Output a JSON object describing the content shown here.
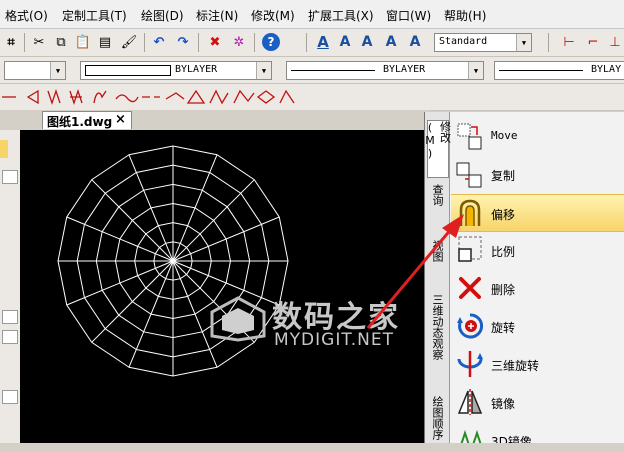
{
  "menu": {
    "items": [
      "格式(O)",
      "定制工具(T)",
      "绘图(D)",
      "标注(N)",
      "修改(M)",
      "扩展工具(X)",
      "窗口(W)",
      "帮助(H)"
    ]
  },
  "toolbar": {
    "text_style": "Standard",
    "layer_color": "BYLAYER",
    "linetype": "BYLAYER",
    "lineweight": "BYLAY"
  },
  "drawing_tab": {
    "label": "图纸1.dwg",
    "close": "×"
  },
  "palette": {
    "tabs": [
      "修改(M)",
      "查询",
      "视图",
      "三维动态观察",
      "绘图顺序"
    ],
    "tools": [
      {
        "label": "Move",
        "icon": "move-icon"
      },
      {
        "label": "复制",
        "icon": "copy-icon"
      },
      {
        "label": "偏移",
        "icon": "offset-icon",
        "selected": true
      },
      {
        "label": "比例",
        "icon": "scale-icon"
      },
      {
        "label": "删除",
        "icon": "delete-icon"
      },
      {
        "label": "旋转",
        "icon": "rotate-icon"
      },
      {
        "label": "三维旋转",
        "icon": "rotate-3d-icon"
      },
      {
        "label": "镜像",
        "icon": "mirror-icon"
      },
      {
        "label": "3D镜像",
        "icon": "mirror-3d-icon"
      }
    ]
  },
  "watermark": {
    "title": "数码之家",
    "subtitle": "MYDIGIT.NET"
  },
  "colors": {
    "canvas": "#000000",
    "drawing": "#ffffff",
    "arrow": "#e02020",
    "selected": "#f7d46a"
  }
}
